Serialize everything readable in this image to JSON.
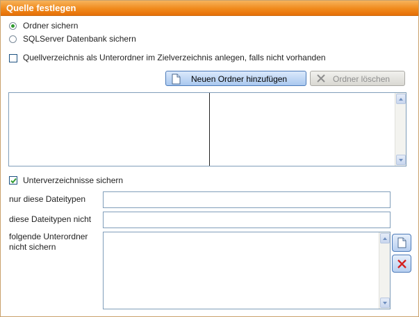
{
  "window": {
    "title": "Quelle festlegen"
  },
  "source_options": [
    {
      "label": "Ordner sichern",
      "selected": true
    },
    {
      "label": "SQLServer Datenbank sichern",
      "selected": false
    }
  ],
  "create_subfolder": {
    "label": "Quellverzeichnis als Unterordner im Zielverzeichnis anlegen, falls nicht vorhanden",
    "checked": false
  },
  "toolbar": {
    "add_folder_label": "Neuen Ordner hinzufügen",
    "delete_folder_label": "Ordner löschen"
  },
  "include_subdirs": {
    "label": "Unterverzeichnisse sichern",
    "checked": true
  },
  "filters": {
    "only_types_label": "nur diese Dateitypen",
    "only_types_value": "",
    "exclude_types_label": "diese Dateitypen nicht",
    "exclude_types_value": "",
    "exclude_folders_label": "folgende Unterordner nicht sichern",
    "exclude_folders_value": ""
  },
  "colors": {
    "title_bar": "#f08a1c",
    "accent_check": "#2f9a2f",
    "delete_icon": "#d42020"
  }
}
